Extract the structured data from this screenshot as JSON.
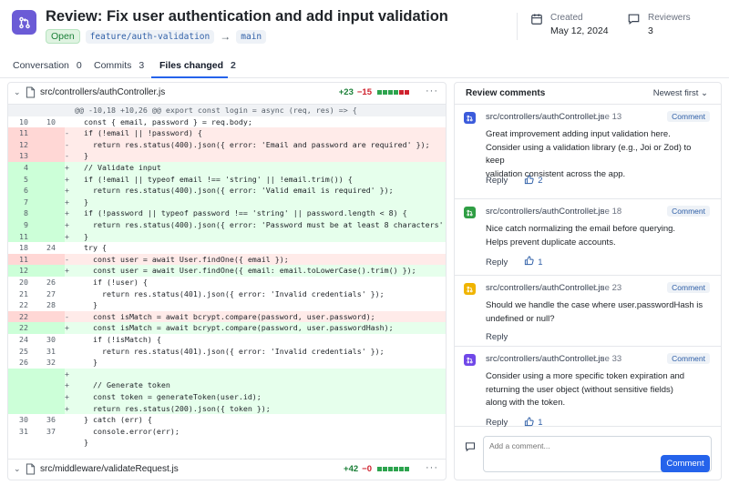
{
  "header": {
    "title": "Review: Fix user authentication and add input validation",
    "status": "Open",
    "source_branch": "feature/auth-validation",
    "target_branch": "main",
    "created_label": "Created",
    "created_date": "May 12, 2024",
    "reviewers_label": "Reviewers",
    "reviewers_count": "3"
  },
  "tabs": [
    {
      "label": "Conversation",
      "count": "0"
    },
    {
      "label": "Commits",
      "count": "3"
    },
    {
      "label": "Files changed",
      "count": "2"
    }
  ],
  "files": [
    {
      "name": "src/controllers/authController.js",
      "additions": "+23",
      "deletions": "−15",
      "blocks": [
        "add",
        "add",
        "add",
        "add",
        "del",
        "del"
      ]
    },
    {
      "name": "src/middleware/validateRequest.js",
      "additions": "+42",
      "deletions": "−0",
      "blocks": [
        "add",
        "add",
        "add",
        "add",
        "add",
        "add"
      ]
    }
  ],
  "diff_lines": [
    {
      "type": "hunk",
      "old": "",
      "new": "",
      "sign": "",
      "text": "@@ -10,18 +10,26 @@ export const login = async (req, res) => {"
    },
    {
      "type": "ctx",
      "old": "10",
      "new": "10",
      "sign": "",
      "text": "  const { email, password } = req.body;"
    },
    {
      "type": "del",
      "old": "11",
      "new": "",
      "sign": "-",
      "text": "  if (!email || !password) {"
    },
    {
      "type": "del",
      "old": "12",
      "new": "",
      "sign": "-",
      "text": "    return res.status(400).json({ error: 'Email and password are required' });"
    },
    {
      "type": "del",
      "old": "13",
      "new": "",
      "sign": "-",
      "text": "  }"
    },
    {
      "type": "add",
      "old": "4",
      "new": "",
      "sign": "+",
      "text": "  // Validate input"
    },
    {
      "type": "add",
      "old": "5",
      "new": "",
      "sign": "+",
      "text": "  if (!email || typeof email !== 'string' || !email.trim()) {"
    },
    {
      "type": "add",
      "old": "6",
      "new": "",
      "sign": "+",
      "text": "    return res.status(400).json({ error: 'Valid email is required' });"
    },
    {
      "type": "add",
      "old": "7",
      "new": "",
      "sign": "+",
      "text": "  }"
    },
    {
      "type": "add",
      "old": "8",
      "new": "",
      "sign": "+",
      "text": "  if (!password || typeof password !== 'string' || password.length < 8) {"
    },
    {
      "type": "add",
      "old": "9",
      "new": "",
      "sign": "+",
      "text": "    return res.status(400).json({ error: 'Password must be at least 8 characters' });"
    },
    {
      "type": "add",
      "old": "11",
      "new": "",
      "sign": "+",
      "text": "  }"
    },
    {
      "type": "ctx",
      "old": "18",
      "new": "24",
      "sign": "",
      "text": "  try {"
    },
    {
      "type": "del",
      "old": "11",
      "new": "",
      "sign": "-",
      "text": "    const user = await User.findOne({ email });"
    },
    {
      "type": "add",
      "old": "12",
      "new": "",
      "sign": "+",
      "text": "    const user = await User.findOne({ email: email.toLowerCase().trim() });"
    },
    {
      "type": "ctx",
      "old": "20",
      "new": "26",
      "sign": "",
      "text": "    if (!user) {"
    },
    {
      "type": "ctx",
      "old": "21",
      "new": "27",
      "sign": "",
      "text": "      return res.status(401).json({ error: 'Invalid credentials' });"
    },
    {
      "type": "ctx",
      "old": "22",
      "new": "28",
      "sign": "",
      "text": "    }"
    },
    {
      "type": "del",
      "old": "22",
      "new": "",
      "sign": "-",
      "text": "    const isMatch = await bcrypt.compare(password, user.password);"
    },
    {
      "type": "add",
      "old": "22",
      "new": "",
      "sign": "+",
      "text": "    const isMatch = await bcrypt.compare(password, user.passwordHash);"
    },
    {
      "type": "ctx",
      "old": "24",
      "new": "30",
      "sign": "",
      "text": "    if (!isMatch) {"
    },
    {
      "type": "ctx",
      "old": "25",
      "new": "31",
      "sign": "",
      "text": "      return res.status(401).json({ error: 'Invalid credentials' });"
    },
    {
      "type": "ctx",
      "old": "26",
      "new": "32",
      "sign": "",
      "text": "    }"
    },
    {
      "type": "add",
      "old": "",
      "new": "",
      "sign": "+",
      "text": ""
    },
    {
      "type": "add",
      "old": "",
      "new": "",
      "sign": "+",
      "text": "    // Generate token"
    },
    {
      "type": "add",
      "old": "",
      "new": "",
      "sign": "+",
      "text": "    const token = generateToken(user.id);"
    },
    {
      "type": "add",
      "old": "",
      "new": "",
      "sign": "+",
      "text": "    return res.status(200).json({ token });"
    },
    {
      "type": "ctx",
      "old": "30",
      "new": "36",
      "sign": "",
      "text": "  } catch (err) {"
    },
    {
      "type": "ctx",
      "old": "31",
      "new": "37",
      "sign": "",
      "text": "    console.error(err);"
    },
    {
      "type": "ctx",
      "old": "",
      "new": "",
      "sign": "",
      "text": "  }"
    }
  ],
  "review": {
    "title": "Review comments",
    "sort": "Newest first",
    "comments": [
      {
        "file": "src/controllers/authController.js",
        "line": "Line 13",
        "tag": "Comment",
        "color": "#3b5bdb",
        "body": [
          "Great improvement adding input validation here.",
          "Consider using a validation library (e.g., Joi or Zod) to keep",
          "validation consistent across the app."
        ],
        "reply": "Reply",
        "likes": "2"
      },
      {
        "file": "src/controllers/authController.js",
        "line": "Line 18",
        "tag": "Comment",
        "color": "#2f9e44",
        "body": [
          "Nice catch normalizing the email before querying.",
          "Helps prevent duplicate accounts."
        ],
        "reply": "Reply",
        "likes": "1"
      },
      {
        "file": "src/controllers/authController.js",
        "line": "Line 23",
        "tag": "Comment",
        "color": "#f0b400",
        "body": [
          "Should we handle the case where user.passwordHash is",
          "undefined or null?"
        ],
        "reply": "Reply",
        "likes": ""
      },
      {
        "file": "src/controllers/authController.js",
        "line": "Line 33",
        "tag": "Comment",
        "color": "#7048e8",
        "body": [
          "Consider using a more specific token expiration and",
          "returning the user object (without sensitive fields)",
          "along with the token."
        ],
        "reply": "Reply",
        "likes": "1"
      }
    ],
    "compose_placeholder": "Add a comment...",
    "compose_button": "Comment"
  }
}
